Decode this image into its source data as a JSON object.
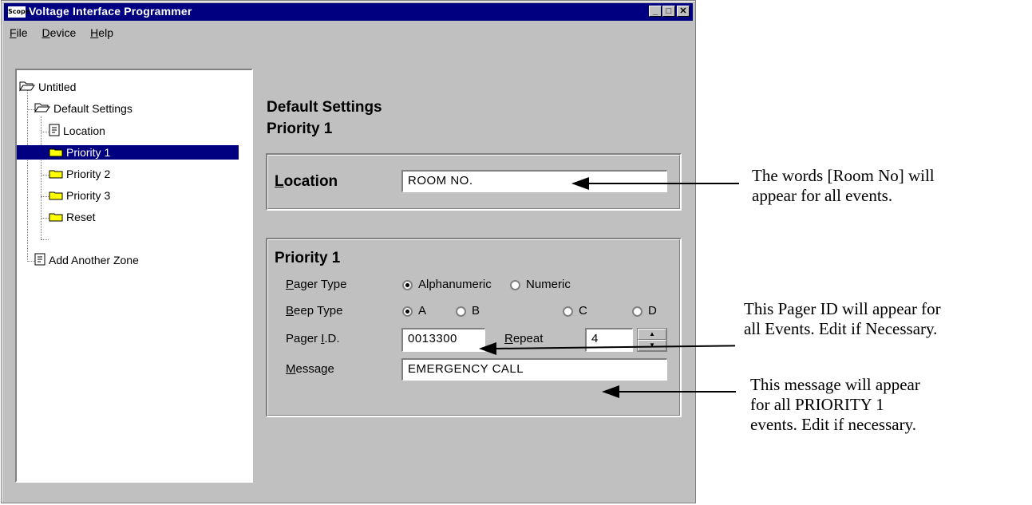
{
  "window": {
    "title": "Voltage Interface Programmer",
    "app_icon_text": "Scope",
    "controls": {
      "minimize": "_",
      "maximize": "□",
      "close": "✕"
    }
  },
  "menu": {
    "file": "File",
    "device": "Device",
    "help": "Help"
  },
  "tree": {
    "root": "Untitled",
    "default_settings": "Default Settings",
    "location": "Location",
    "priority1": "Priority 1",
    "priority2": "Priority 2",
    "priority3": "Priority 3",
    "reset": "Reset",
    "add_zone": "Add Another Zone"
  },
  "header": {
    "line1": "Default Settings",
    "line2": "Priority 1"
  },
  "location_group": {
    "label_first": "L",
    "label_rest": "ocation",
    "value": "ROOM NO."
  },
  "priority_group": {
    "title": "Priority 1",
    "pager_type_label_first": "P",
    "pager_type_label_rest": "ager Type",
    "pager_type_options": [
      "Alphanumeric",
      "Numeric"
    ],
    "pager_type_selected": "Alphanumeric",
    "beep_type_label_first": "B",
    "beep_type_label_rest": "eep Type",
    "beep_type_options": [
      "A",
      "B",
      "C",
      "D"
    ],
    "beep_type_selected": "A",
    "pager_id_label_pre": "Pager ",
    "pager_id_label_u": "I",
    "pager_id_label_post": ".D.",
    "pager_id_value": "0013300",
    "repeat_label_first": "R",
    "repeat_label_rest": "epeat",
    "repeat_value": "4",
    "message_label_first": "M",
    "message_label_rest": "essage",
    "message_value": "EMERGENCY CALL"
  },
  "annotations": {
    "location_note_1": "The words [Room No]  will",
    "location_note_2": "appear for all  events.",
    "pager_note_1": "This Pager ID will appear for",
    "pager_note_2": "all Events. Edit if Necessary.",
    "message_note_1": "This message will appear",
    "message_note_2": "for all PRIORITY 1",
    "message_note_3": "events. Edit if necessary."
  }
}
